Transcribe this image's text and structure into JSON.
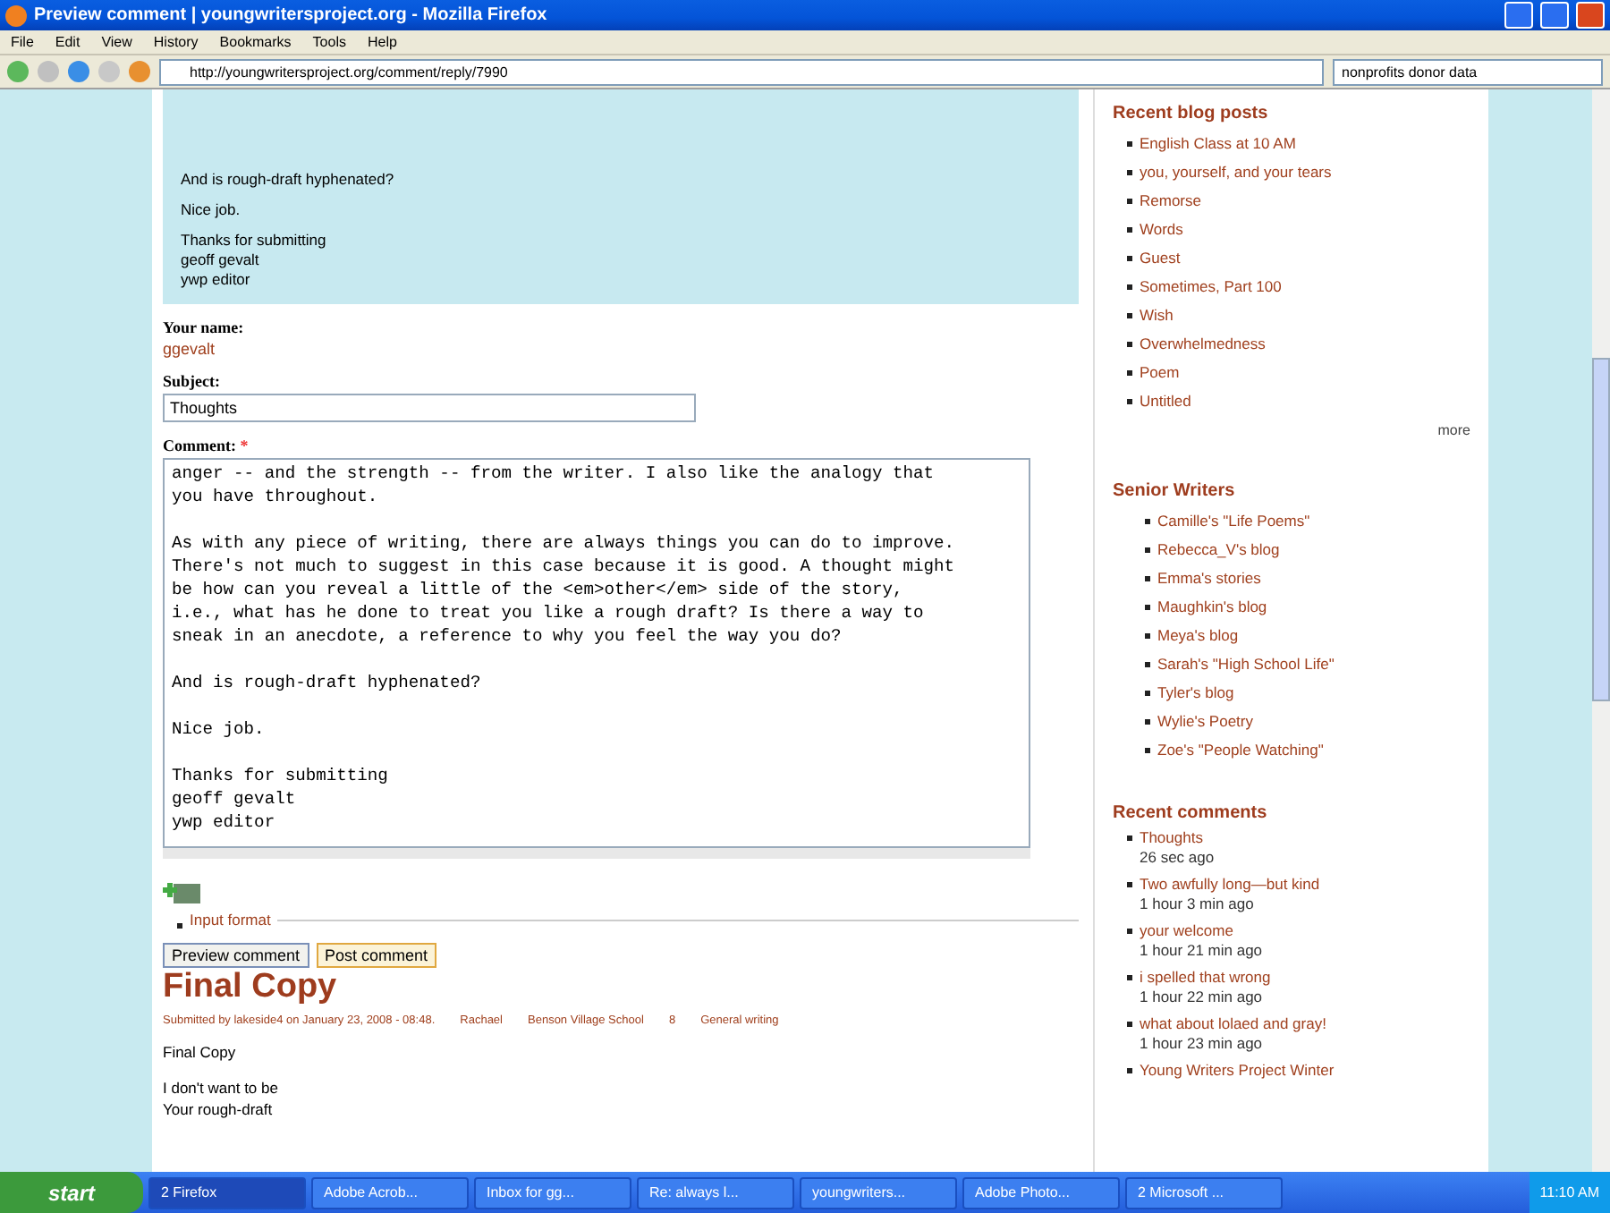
{
  "window": {
    "title": "Preview comment | youngwritersproject.org - Mozilla Firefox"
  },
  "menu": [
    "File",
    "Edit",
    "View",
    "History",
    "Bookmarks",
    "Tools",
    "Help"
  ],
  "address": {
    "value": "http://youngwritersproject.org/comment/reply/7990"
  },
  "search": {
    "value": "nonprofits donor data"
  },
  "preview": {
    "lines": [
      "And is rough-draft hyphenated?",
      "Nice job.",
      "Thanks for submitting\ngeoff gevalt\nywp editor"
    ]
  },
  "form": {
    "name_label": "Your name:",
    "name_value": "ggevalt",
    "subject_label": "Subject:",
    "subject_value": "Thoughts",
    "comment_label": "Comment:",
    "required_mark": "*",
    "comment_value": "anger -- and the strength -- from the writer. I also like the analogy that\nyou have throughout.\n\nAs with any piece of writing, there are always things you can do to improve.\nThere's not much to suggest in this case because it is good. A thought might\nbe how can you reveal a little of the <em>other</em> side of the story,\ni.e., what has he done to treat you like a rough draft? Is there a way to\nsneak in an anecdote, a reference to why you feel the way you do?\n\nAnd is rough-draft hyphenated?\n\nNice job.\n\nThanks for submitting\ngeoff gevalt\nywp editor",
    "input_format": "Input format",
    "buttons": [
      {
        "label": "Preview comment",
        "focused": false
      },
      {
        "label": "Post comment",
        "focused": true
      }
    ]
  },
  "post": {
    "title": "Final Copy",
    "submitted": "Submitted by lakeside4 on January 23, 2008 - 08:48.",
    "tags": [
      "Rachael",
      "Benson Village School",
      "8",
      "General writing"
    ],
    "body": [
      "Final Copy",
      "I don't want to be\nYour rough-draft"
    ]
  },
  "sidebar": {
    "blog_title": "Recent blog posts",
    "blog_posts": [
      "English Class at 10 AM",
      "you, yourself, and your tears",
      "Remorse",
      "Words",
      "Guest",
      "Sometimes, Part 100",
      "Wish",
      "Overwhelmedness",
      "Poem",
      "Untitled"
    ],
    "more": "more",
    "senior_title": "Senior Writers",
    "senior_writers": [
      "Camille's \"Life Poems\"",
      "Rebecca_V's blog",
      "Emma's stories",
      "Maughkin's blog",
      "Meya's blog",
      "Sarah's \"High School Life\"",
      "Tyler's blog",
      "Wylie's Poetry",
      "Zoe's \"People Watching\""
    ],
    "comments_title": "Recent comments",
    "comments": [
      {
        "title": "Thoughts",
        "time": "26 sec ago"
      },
      {
        "title": "Two awfully long—but kind",
        "time": "1 hour 3 min ago"
      },
      {
        "title": "your welcome",
        "time": "1 hour 21 min ago"
      },
      {
        "title": "i spelled that wrong",
        "time": "1 hour 22 min ago"
      },
      {
        "title": "what about lolaed and gray!",
        "time": "1 hour 23 min ago"
      },
      {
        "title": "Young Writers Project Winter"
      }
    ]
  },
  "taskbar": {
    "start": "start",
    "items": [
      {
        "label": "2 Firefox",
        "selected": true
      },
      {
        "label": "Adobe Acrob...",
        "selected": false
      },
      {
        "label": "Inbox for gg...",
        "selected": false
      },
      {
        "label": "Re: always l...",
        "selected": false
      },
      {
        "label": "youngwriters...",
        "selected": false
      },
      {
        "label": "Adobe Photo...",
        "selected": false
      },
      {
        "label": "2 Microsoft ...",
        "selected": false
      }
    ],
    "clock": "11:10 AM"
  }
}
